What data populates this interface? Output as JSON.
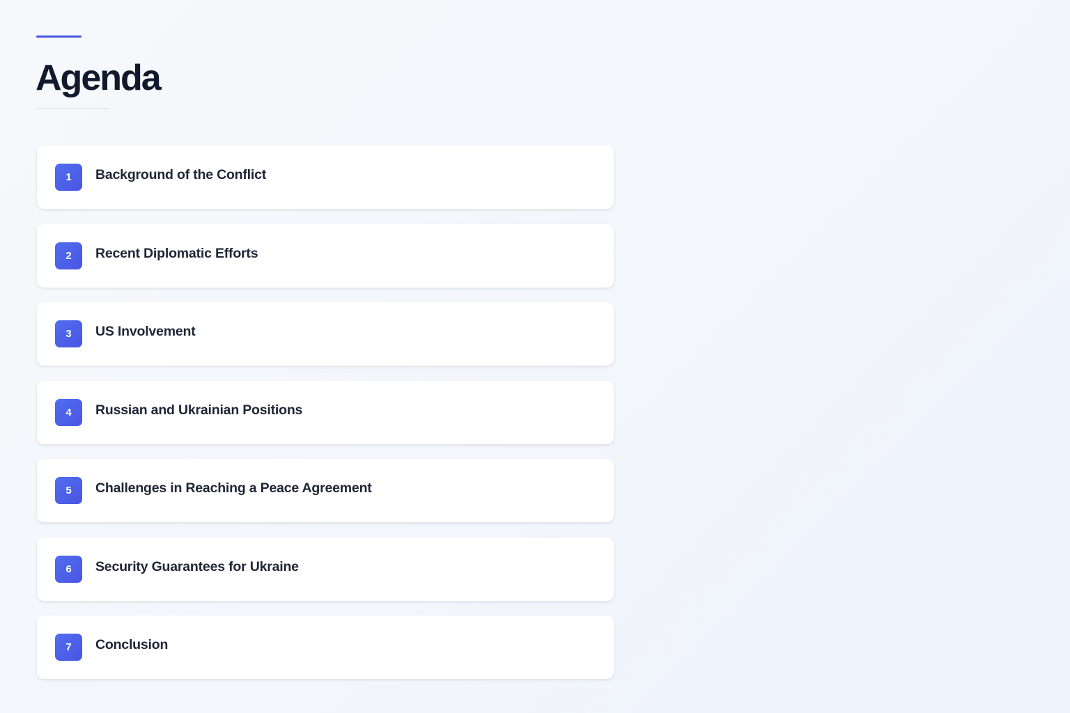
{
  "header": {
    "title": "Agenda"
  },
  "colors": {
    "accent": "#4457e3",
    "badge": "#4a5ee8",
    "title": "#111a2c",
    "item_text": "#1e2535",
    "card": "#ffffff",
    "background": "#f4f7fb"
  },
  "agenda": {
    "items": [
      {
        "number": "1",
        "label": "Background of the Conflict"
      },
      {
        "number": "2",
        "label": "Recent Diplomatic Efforts"
      },
      {
        "number": "3",
        "label": "US Involvement"
      },
      {
        "number": "4",
        "label": "Russian and Ukrainian Positions"
      },
      {
        "number": "5",
        "label": "Challenges in Reaching a Peace Agreement"
      },
      {
        "number": "6",
        "label": "Security Guarantees for Ukraine"
      },
      {
        "number": "7",
        "label": "Conclusion"
      }
    ]
  }
}
